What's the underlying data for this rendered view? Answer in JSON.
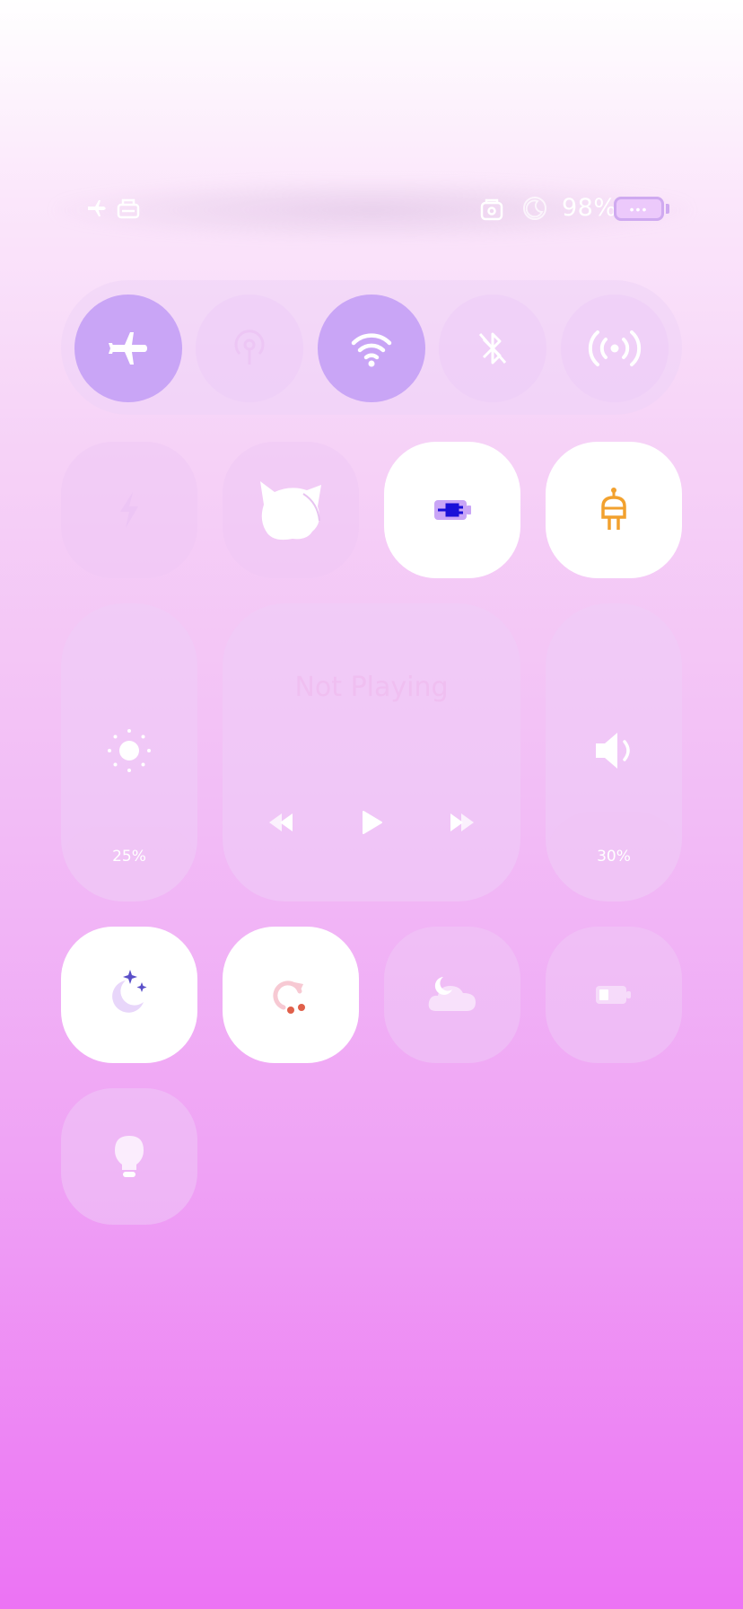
{
  "status_bar": {
    "carrier_text": "",
    "battery_percent": "98%",
    "battery_indicator": "•••",
    "left_icons": [
      "airplane-mode-status-icon",
      "storage-status-icon"
    ],
    "right_icons": [
      "lock-rotation-icon",
      "sleep-mode-icon"
    ]
  },
  "connectivity": [
    {
      "name": "airplane-mode",
      "icon": "airplane-icon",
      "active": true
    },
    {
      "name": "mobile-data",
      "icon": "antenna-icon",
      "active": false
    },
    {
      "name": "wifi",
      "icon": "wifi-icon",
      "active": true
    },
    {
      "name": "bluetooth",
      "icon": "bluetooth-icon",
      "active": false
    },
    {
      "name": "hotspot",
      "icon": "hotspot-icon",
      "active": false
    }
  ],
  "quick_tiles_row1": [
    {
      "name": "power-saving",
      "icon": "lightning-icon",
      "active": false
    },
    {
      "name": "cat-app",
      "icon": "cat-icon",
      "active": false
    },
    {
      "name": "charging",
      "icon": "plug-battery-icon",
      "active": true
    },
    {
      "name": "adapter",
      "icon": "plug-icon",
      "active": true
    }
  ],
  "brightness": {
    "value_label": "25%",
    "level": 0.25,
    "icon": "sun-icon"
  },
  "media": {
    "title": "Not Playing",
    "controls": [
      "rewind-icon",
      "play-icon",
      "fast-forward-icon"
    ]
  },
  "volume": {
    "value_label": "30%",
    "level": 0.3,
    "icon": "speaker-icon"
  },
  "quick_tiles_row2": [
    {
      "name": "night-mode",
      "icon": "moon-stars-icon",
      "active": true
    },
    {
      "name": "sync",
      "icon": "sync-icon",
      "active": true
    },
    {
      "name": "weather",
      "icon": "cloud-moon-icon",
      "active": false
    },
    {
      "name": "battery-saver",
      "icon": "battery-icon",
      "active": false
    }
  ],
  "quick_tiles_row3": [
    {
      "name": "flashlight",
      "icon": "lightbulb-icon",
      "active": false
    }
  ],
  "colors": {
    "accent": "#c9a5f6",
    "tile_on": "#ffffff",
    "charging_plug": "#1a10d8",
    "adapter_plug": "#f2a12e",
    "sync_dots": "#e0604a",
    "night_stars": "#5a4fc8"
  }
}
